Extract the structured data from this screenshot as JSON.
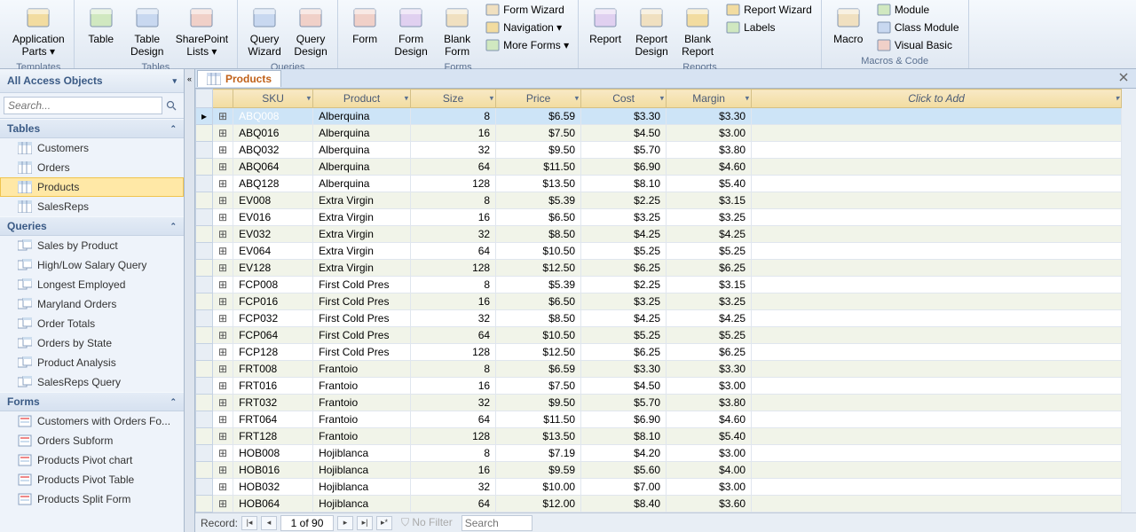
{
  "ribbon": {
    "groups": [
      {
        "label": "Templates",
        "large": [
          {
            "name": "application-parts",
            "label": "Application\nParts ▾"
          }
        ]
      },
      {
        "label": "Tables",
        "large": [
          {
            "name": "table",
            "label": "Table"
          },
          {
            "name": "table-design",
            "label": "Table\nDesign"
          },
          {
            "name": "sharepoint-lists",
            "label": "SharePoint\nLists ▾"
          }
        ]
      },
      {
        "label": "Queries",
        "large": [
          {
            "name": "query-wizard",
            "label": "Query\nWizard"
          },
          {
            "name": "query-design",
            "label": "Query\nDesign"
          }
        ]
      },
      {
        "label": "Forms",
        "large": [
          {
            "name": "form",
            "label": "Form"
          },
          {
            "name": "form-design",
            "label": "Form\nDesign"
          },
          {
            "name": "blank-form",
            "label": "Blank\nForm"
          }
        ],
        "small": [
          {
            "name": "form-wizard",
            "label": "Form Wizard"
          },
          {
            "name": "navigation",
            "label": "Navigation ▾"
          },
          {
            "name": "more-forms",
            "label": "More Forms ▾"
          }
        ]
      },
      {
        "label": "Reports",
        "large": [
          {
            "name": "report",
            "label": "Report"
          },
          {
            "name": "report-design",
            "label": "Report\nDesign"
          },
          {
            "name": "blank-report",
            "label": "Blank\nReport"
          }
        ],
        "small": [
          {
            "name": "report-wizard",
            "label": "Report Wizard"
          },
          {
            "name": "labels",
            "label": "Labels"
          }
        ]
      },
      {
        "label": "Macros & Code",
        "large": [
          {
            "name": "macro",
            "label": "Macro"
          }
        ],
        "small": [
          {
            "name": "module",
            "label": "Module"
          },
          {
            "name": "class-module",
            "label": "Class Module"
          },
          {
            "name": "visual-basic",
            "label": "Visual Basic"
          }
        ]
      }
    ]
  },
  "nav": {
    "title": "All Access Objects",
    "search_placeholder": "Search...",
    "sections": [
      {
        "name": "Tables",
        "items": [
          "Customers",
          "Orders",
          "Products",
          "SalesReps"
        ],
        "selected": "Products",
        "icon": "table"
      },
      {
        "name": "Queries",
        "items": [
          "Sales by Product",
          "High/Low Salary Query",
          "Longest Employed",
          "Maryland Orders",
          "Order Totals",
          "Orders by State",
          "Product Analysis",
          "SalesReps Query"
        ],
        "icon": "query"
      },
      {
        "name": "Forms",
        "items": [
          "Customers with Orders Fo...",
          "Orders Subform",
          "Products Pivot chart",
          "Products Pivot Table",
          "Products Split Form"
        ],
        "icon": "form"
      }
    ]
  },
  "tab": {
    "title": "Products"
  },
  "grid": {
    "columns": [
      "SKU",
      "Product",
      "Size",
      "Price",
      "Cost",
      "Margin"
    ],
    "add_label": "Click to Add",
    "rows": [
      {
        "sku": "ABQ008",
        "product": "Alberquina",
        "size": 8,
        "price": "$6.59",
        "cost": "$3.30",
        "margin": "$3.30",
        "sel": true
      },
      {
        "sku": "ABQ016",
        "product": "Alberquina",
        "size": 16,
        "price": "$7.50",
        "cost": "$4.50",
        "margin": "$3.00"
      },
      {
        "sku": "ABQ032",
        "product": "Alberquina",
        "size": 32,
        "price": "$9.50",
        "cost": "$5.70",
        "margin": "$3.80"
      },
      {
        "sku": "ABQ064",
        "product": "Alberquina",
        "size": 64,
        "price": "$11.50",
        "cost": "$6.90",
        "margin": "$4.60"
      },
      {
        "sku": "ABQ128",
        "product": "Alberquina",
        "size": 128,
        "price": "$13.50",
        "cost": "$8.10",
        "margin": "$5.40"
      },
      {
        "sku": "EV008",
        "product": "Extra Virgin",
        "size": 8,
        "price": "$5.39",
        "cost": "$2.25",
        "margin": "$3.15"
      },
      {
        "sku": "EV016",
        "product": "Extra Virgin",
        "size": 16,
        "price": "$6.50",
        "cost": "$3.25",
        "margin": "$3.25"
      },
      {
        "sku": "EV032",
        "product": "Extra Virgin",
        "size": 32,
        "price": "$8.50",
        "cost": "$4.25",
        "margin": "$4.25"
      },
      {
        "sku": "EV064",
        "product": "Extra Virgin",
        "size": 64,
        "price": "$10.50",
        "cost": "$5.25",
        "margin": "$5.25"
      },
      {
        "sku": "EV128",
        "product": "Extra Virgin",
        "size": 128,
        "price": "$12.50",
        "cost": "$6.25",
        "margin": "$6.25"
      },
      {
        "sku": "FCP008",
        "product": "First Cold Pres",
        "size": 8,
        "price": "$5.39",
        "cost": "$2.25",
        "margin": "$3.15"
      },
      {
        "sku": "FCP016",
        "product": "First Cold Pres",
        "size": 16,
        "price": "$6.50",
        "cost": "$3.25",
        "margin": "$3.25"
      },
      {
        "sku": "FCP032",
        "product": "First Cold Pres",
        "size": 32,
        "price": "$8.50",
        "cost": "$4.25",
        "margin": "$4.25"
      },
      {
        "sku": "FCP064",
        "product": "First Cold Pres",
        "size": 64,
        "price": "$10.50",
        "cost": "$5.25",
        "margin": "$5.25"
      },
      {
        "sku": "FCP128",
        "product": "First Cold Pres",
        "size": 128,
        "price": "$12.50",
        "cost": "$6.25",
        "margin": "$6.25"
      },
      {
        "sku": "FRT008",
        "product": "Frantoio",
        "size": 8,
        "price": "$6.59",
        "cost": "$3.30",
        "margin": "$3.30"
      },
      {
        "sku": "FRT016",
        "product": "Frantoio",
        "size": 16,
        "price": "$7.50",
        "cost": "$4.50",
        "margin": "$3.00"
      },
      {
        "sku": "FRT032",
        "product": "Frantoio",
        "size": 32,
        "price": "$9.50",
        "cost": "$5.70",
        "margin": "$3.80"
      },
      {
        "sku": "FRT064",
        "product": "Frantoio",
        "size": 64,
        "price": "$11.50",
        "cost": "$6.90",
        "margin": "$4.60"
      },
      {
        "sku": "FRT128",
        "product": "Frantoio",
        "size": 128,
        "price": "$13.50",
        "cost": "$8.10",
        "margin": "$5.40"
      },
      {
        "sku": "HOB008",
        "product": "Hojiblanca",
        "size": 8,
        "price": "$7.19",
        "cost": "$4.20",
        "margin": "$3.00"
      },
      {
        "sku": "HOB016",
        "product": "Hojiblanca",
        "size": 16,
        "price": "$9.59",
        "cost": "$5.60",
        "margin": "$4.00"
      },
      {
        "sku": "HOB032",
        "product": "Hojiblanca",
        "size": 32,
        "price": "$10.00",
        "cost": "$7.00",
        "margin": "$3.00"
      },
      {
        "sku": "HOB064",
        "product": "Hojiblanca",
        "size": 64,
        "price": "$12.00",
        "cost": "$8.40",
        "margin": "$3.60"
      }
    ]
  },
  "record_nav": {
    "label": "Record:",
    "pos": "1 of 90",
    "filter": "No Filter",
    "search": "Search"
  }
}
